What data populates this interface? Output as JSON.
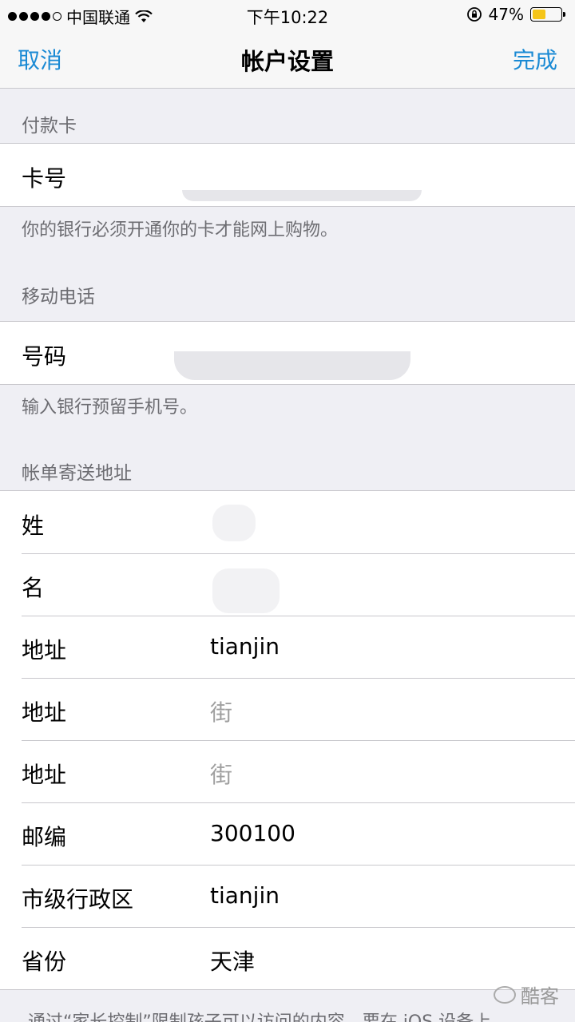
{
  "status_bar": {
    "carrier": "中国联通",
    "time": "下午10:22",
    "battery_percent": "47%",
    "battery_level": 0.47,
    "battery_color": "#f5c518"
  },
  "nav": {
    "cancel_label": "取消",
    "title": "帐户设置",
    "done_label": "完成",
    "accent_color": "#1a8ad4"
  },
  "payment_card": {
    "header": "付款卡",
    "label": "卡号",
    "footer": "你的银行必须开通你的卡才能网上购物。"
  },
  "mobile_phone": {
    "header": "移动电话",
    "label": "号码",
    "footer": "输入银行预留手机号。"
  },
  "billing_address": {
    "header": "帐单寄送地址",
    "rows": [
      {
        "label": "姓",
        "value": "",
        "placeholder": false
      },
      {
        "label": "名",
        "value": "",
        "placeholder": false
      },
      {
        "label": "地址",
        "value": "tianjin",
        "placeholder": false
      },
      {
        "label": "地址",
        "value": "街",
        "placeholder": true
      },
      {
        "label": "地址",
        "value": "街",
        "placeholder": true
      },
      {
        "label": "邮编",
        "value": "300100",
        "placeholder": false
      },
      {
        "label": "市级行政区",
        "value": "tianjin",
        "placeholder": false
      },
      {
        "label": "省份",
        "value": "天津",
        "placeholder": false
      }
    ]
  },
  "bottom_text": "通过“家长控制”限制孩子可以访问的内容，要在 iOS 设备上",
  "watermark": "酷客"
}
